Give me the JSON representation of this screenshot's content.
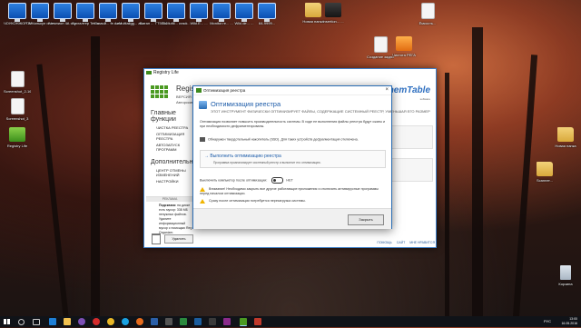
{
  "desktop": {
    "icons_top": [
      {
        "label": "ЧОУКОНЖОР-ЗЕР...",
        "kind": "monitor"
      },
      {
        "label": "ПМКалькул drcvt4n",
        "kind": "monitor"
      },
      {
        "label": "Чемпион 4А сериал",
        "kind": "monitor"
      },
      {
        "label": "Бухгалтер Tetris",
        "kind": "monitor"
      },
      {
        "label": "Самый... fe.damI",
        "kind": "monitor"
      },
      {
        "label": "zMultialigg... aw.mit...",
        "kind": "monitor"
      },
      {
        "label": "Вотан ... TT5E12...",
        "kind": "monitor"
      },
      {
        "label": "3xMultil... crack...",
        "kind": "monitor"
      },
      {
        "label": "Wiki.E... ...",
        "kind": "monitor"
      },
      {
        "label": "Monitor.re... ...",
        "kind": "monitor"
      },
      {
        "label": "Wiki.de... ...",
        "kind": "monitor"
      },
      {
        "label": "64-9999...",
        "kind": "monitor"
      },
      {
        "label": "Новая папка",
        "kind": "folder"
      },
      {
        "label": "Insertion... ...",
        "kind": "app"
      }
    ],
    "icons_left": [
      {
        "label": "Screenshot_2-16052...",
        "kind": "doc"
      },
      {
        "label": "Screenshot_3",
        "kind": "doc"
      },
      {
        "label": "Registry Life",
        "kind": "green"
      }
    ],
    "icons_right": [
      {
        "label": "Создание задачи",
        "kind": "doc"
      },
      {
        "label": "Чистота РЕГА",
        "kind": "orange"
      },
      {
        "label": "Ёмкость...",
        "kind": "doc"
      },
      {
        "label": "Новая папка",
        "kind": "folder"
      },
      {
        "label": "Scanner...",
        "kind": "folder"
      },
      {
        "label": "Корзина",
        "kind": "bin"
      }
    ]
  },
  "main_window": {
    "title": "Registry Life",
    "app_name": "Registry Life",
    "version": "ВЕРСИЯ 4.10",
    "author": "Авторские права",
    "brand": "ChemTable",
    "brand_sub": "software",
    "sidebar": {
      "section1": "Главные функции",
      "items1": [
        "ЧИСТКА РЕЕСТРА",
        "ОПТИМИЗАЦИЯ РЕЕСТРА",
        "АВТОЗАПУСК ПРОГРАММ"
      ],
      "section2": "Дополнительно",
      "items2": [
        "ЦЕНТР ОТМЕНЫ ИЗМЕНЕНИЙ",
        "НАСТРОЙКИ"
      ]
    },
    "ad": {
      "header": "РЕКЛАМА",
      "bold": "Подсказка:",
      "text": "на диске есть мусор: 338 МБ ненужных файлов. Удалите информационный мусор с помощью Reg Organizer.",
      "button": "Удалить"
    },
    "footer": {
      "help": "ПОМОЩЬ",
      "site": "САЙТ",
      "like": "МНЕ НРАВИТСЯ"
    }
  },
  "dialog": {
    "title": "Оптимизация реестра",
    "heading": "Оптимизация реестра",
    "subheading": "ЭТОТ ИНСТРУМЕНТ ФИЗИЧЕСКИ ОПТИМИЗИРУЕТ ФАЙЛЫ, СОДЕРЖАЩИЕ СИСТЕМНЫЙ РЕЕСТР, УМЕНЬШАЯ ЕГО РАЗМЕР",
    "description": "Оптимизация позволяет повысить производительность системы. В ходе ее выполнения файлы реестра будут сжаты и при необходимости дефрагментированы.",
    "ssd_note": "Обнаружен твердотельный накопитель (SSD). Для таких устройств дефрагментация отключена.",
    "run_label": "Выполнить оптимизацию реестра",
    "run_sub": "Программа проанализирует системный реестр и выполнит его оптимизацию.",
    "shutdown_label": "Выключить компьютер после оптимизации:",
    "shutdown_value": "НЕТ",
    "warning1": "Внимание! Необходимо закрыть все другие работающие приложения и отключить антивирусные программы перед началом оптимизации.",
    "warning2": "Сразу после оптимизации потребуется перезагрузка системы.",
    "close_button": "Закрыть"
  },
  "taskbar": {
    "lang": "РУС",
    "time": "13:00",
    "date": "16.05.2016"
  }
}
